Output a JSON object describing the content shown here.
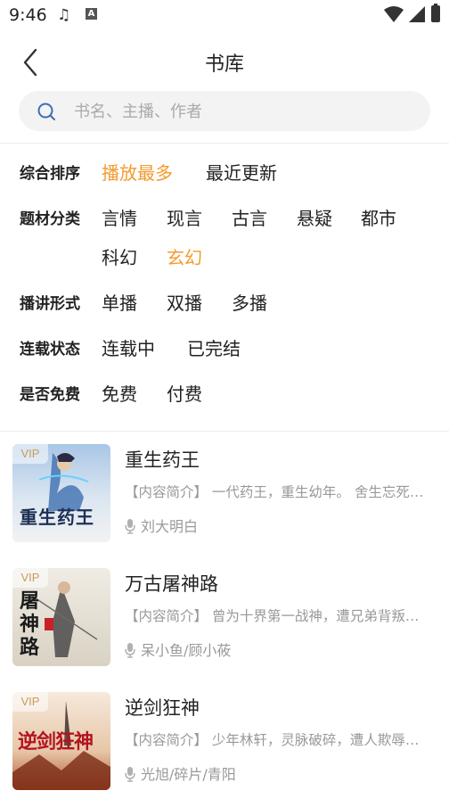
{
  "status_bar": {
    "time": "9:46",
    "a_badge": "A",
    "music_icon": "music-note-icon",
    "icons": [
      "wifi-icon",
      "signal-icon",
      "battery-icon"
    ]
  },
  "header": {
    "title": "书库",
    "back_icon": "chevron-left-icon"
  },
  "search": {
    "placeholder": "书名、主播、作者",
    "icon": "search-icon"
  },
  "filters": [
    {
      "label": "综合排序",
      "options": [
        "播放最多",
        "最近更新"
      ],
      "selected": "播放最多"
    },
    {
      "label": "题材分类",
      "options": [
        "言情",
        "现言",
        "古言",
        "悬疑",
        "都市",
        "科幻",
        "玄幻"
      ],
      "selected": "玄幻"
    },
    {
      "label": "播讲形式",
      "options": [
        "单播",
        "双播",
        "多播"
      ],
      "selected": null
    },
    {
      "label": "连载状态",
      "options": [
        "连载中",
        "已完结"
      ],
      "selected": null
    },
    {
      "label": "是否免费",
      "options": [
        "免费",
        "付费"
      ],
      "selected": null
    }
  ],
  "colors": {
    "accent": "#f39a2c",
    "vip_text": "#c89b5a",
    "muted_text": "#999999"
  },
  "books": [
    {
      "title": "重生药王",
      "badge": "VIP",
      "description": "【内容简介】 一代药王，重生幼年。 舍生忘死…",
      "narrator": "刘大明白",
      "cover_text": "重生药王"
    },
    {
      "title": "万古屠神路",
      "badge": "VIP",
      "description": "【内容简介】 曾为十界第一战神，遭兄弟背叛…",
      "narrator": "呆小鱼/顾小莜",
      "cover_text": "屠神路"
    },
    {
      "title": "逆剑狂神",
      "badge": "VIP",
      "description": "【内容简介】 少年林轩，灵脉破碎，遭人欺辱…",
      "narrator": "光旭/碎片/青阳",
      "cover_text": "逆剑狂神"
    }
  ]
}
